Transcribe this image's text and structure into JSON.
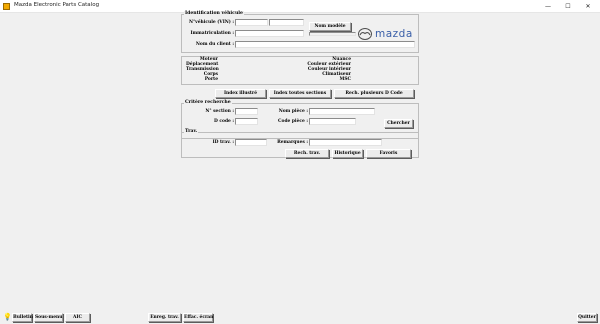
{
  "window": {
    "title": "Mazda Electronic Parts Catalog",
    "minimize": "—",
    "maximize": "☐",
    "close": "✕"
  },
  "brand": {
    "logo_text": "mazda",
    "logo_color": "#3a5fa8"
  },
  "vehicle_id": {
    "group_label": "Identification véhicule",
    "vin_label": "N°véhicule (VIN) :",
    "registration_label": "Immatriculation :",
    "client_name_label": "Nom du client :",
    "model_name_button": "Nom modèle",
    "vin_value": "",
    "vin_value_2": "",
    "registration_value": "",
    "client_name_value": ""
  },
  "vehicle_info": {
    "left_labels": [
      "Moteur",
      "Déplacement",
      "Transmission",
      "Corps",
      "Porte"
    ],
    "right_labels": [
      "Nuance",
      "Couleur extérieur",
      "Couleur intérieur",
      "Climatiseur",
      "MSC"
    ]
  },
  "index_buttons": {
    "illustrated": "Index illustré",
    "all_sections": "Index toutes sections",
    "d_code_search": "Rech. plusieurs D Code"
  },
  "search_criteria": {
    "group_label": "Critère recherche",
    "section_no_label": "N° section :",
    "d_code_label": "D code :",
    "part_name_label": "Nom pièce :",
    "part_code_label": "Code pièce :",
    "search_button": "Chercher",
    "section_no_value": "",
    "d_code_value": "",
    "part_name_value": "",
    "part_code_value": ""
  },
  "work": {
    "group_label": "Trav.",
    "id_label": "ID trav. :",
    "remarks_label": "Remarques :",
    "search_work_button": "Rech. trav.",
    "history_button": "Historique",
    "favorites_button": "Favoris",
    "id_value": "",
    "remarks_value": ""
  },
  "statusbar": {
    "bulletin": "Bulletin",
    "sous_menu": "Sous-menu",
    "aic": "AIC",
    "save_work": "Enreg. trav.",
    "clear_screen": "Effac. écran",
    "quit": "Quitter"
  }
}
